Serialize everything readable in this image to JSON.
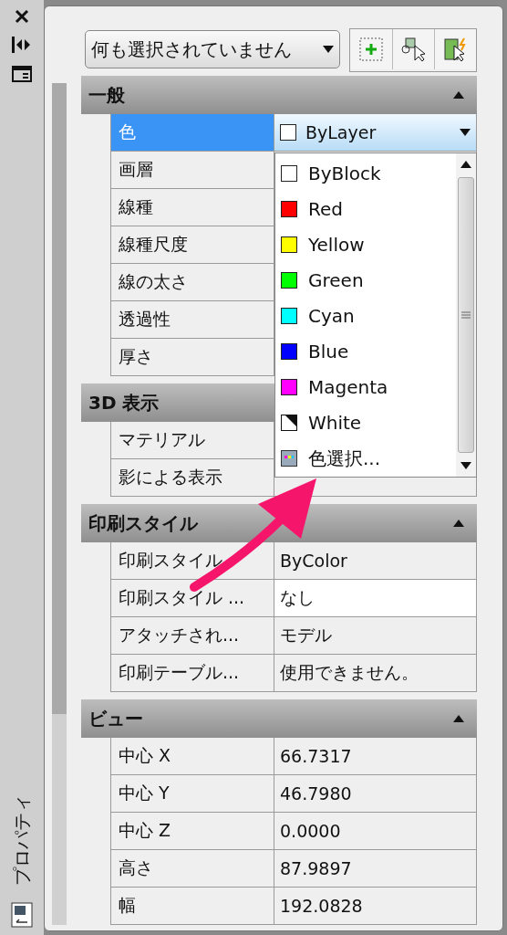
{
  "side_title": "プロパティ",
  "selection": {
    "value": "何も選択されていません"
  },
  "sections": [
    {
      "title": "一般",
      "expanded": true,
      "rows": [
        {
          "label": "色",
          "value": "ByLayer",
          "kind": "color-combo",
          "selected": true
        },
        {
          "label": "画層",
          "kind": "text",
          "selected": false
        },
        {
          "label": "線種",
          "kind": "text",
          "selected": false
        },
        {
          "label": "線種尺度",
          "kind": "text",
          "selected": false
        },
        {
          "label": "線の太さ",
          "kind": "text",
          "selected": false
        },
        {
          "label": "透過性",
          "kind": "text",
          "selected": false
        },
        {
          "label": "厚さ",
          "kind": "text",
          "selected": false
        }
      ]
    },
    {
      "title": "3D 表示",
      "rows": [
        {
          "label": "マテリアル",
          "kind": "text",
          "selected": false
        },
        {
          "label": "影による表示",
          "kind": "text",
          "selected": false
        }
      ]
    },
    {
      "title": "印刷スタイル",
      "expanded": true,
      "rows": [
        {
          "label": "印刷スタイル",
          "value": "ByColor",
          "kind": "text",
          "selected": false
        },
        {
          "label": "印刷スタイル ...",
          "value": "なし",
          "kind": "field",
          "selected": false
        },
        {
          "label": "アタッチされ...",
          "value": "モデル",
          "kind": "text",
          "selected": false
        },
        {
          "label": "印刷テーブル...",
          "value": "使用できません。",
          "kind": "text",
          "selected": false
        }
      ]
    },
    {
      "title": "ビュー",
      "expanded": true,
      "rows": [
        {
          "label": "中心 X",
          "value": "66.7317",
          "kind": "text",
          "selected": false
        },
        {
          "label": "中心 Y",
          "value": "46.7980",
          "kind": "text",
          "selected": false
        },
        {
          "label": "中心 Z",
          "value": "0.0000",
          "kind": "text",
          "selected": false
        },
        {
          "label": "高さ",
          "value": "87.9897",
          "kind": "text",
          "selected": false
        },
        {
          "label": "幅",
          "value": "192.0828",
          "kind": "text",
          "selected": false
        }
      ]
    }
  ],
  "color_list": [
    {
      "label": "ByBlock",
      "kind": "swatch",
      "color": "#ffffff"
    },
    {
      "label": "Red",
      "kind": "swatch",
      "color": "#ff0000"
    },
    {
      "label": "Yellow",
      "kind": "swatch",
      "color": "#ffff00"
    },
    {
      "label": "Green",
      "kind": "swatch",
      "color": "#00ff00"
    },
    {
      "label": "Cyan",
      "kind": "swatch",
      "color": "#00ffff"
    },
    {
      "label": "Blue",
      "kind": "swatch",
      "color": "#0000ff"
    },
    {
      "label": "Magenta",
      "kind": "swatch",
      "color": "#ff00ff"
    },
    {
      "label": "White",
      "kind": "split",
      "color": "#ffffff"
    },
    {
      "label": "色選択...",
      "kind": "picker"
    }
  ]
}
